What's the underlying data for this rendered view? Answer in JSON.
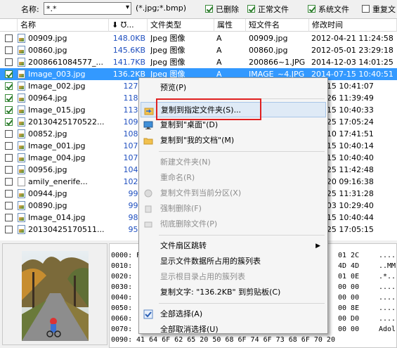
{
  "filter": {
    "name_label": "名称:",
    "name_value": "*.*",
    "ext_hint": "(*.jpg;*.bmp)",
    "checks": [
      {
        "label": "已删除",
        "checked": true
      },
      {
        "label": "正常文件",
        "checked": true
      },
      {
        "label": "系统文件",
        "checked": true
      },
      {
        "label": "重复文",
        "checked": false
      }
    ]
  },
  "columns": [
    "名称",
    "⬇ ℧...",
    "文件类型",
    "属性",
    "短文件名",
    "修改时间"
  ],
  "rows": [
    {
      "name": "00909.jpg",
      "size": "148.0KB",
      "type": "Jpeg 图像",
      "attr": "A",
      "short": "00909.jpg",
      "time": "2012-04-21 11:24:58",
      "checked": false,
      "icon": "jpg"
    },
    {
      "name": "00860.jpg",
      "size": "145.6KB",
      "type": "Jpeg 图像",
      "attr": "A",
      "short": "00860.jpg",
      "time": "2012-05-01 23:29:18",
      "checked": false,
      "icon": "jpg"
    },
    {
      "name": "2008661084577_...",
      "size": "141.7KB",
      "type": "Jpeg 图像",
      "attr": "A",
      "short": "200866~1.JPG",
      "time": "2014-12-03 14:01:25",
      "checked": false,
      "icon": "jpg"
    },
    {
      "name": "Image_003.jpg",
      "size": "136.2KB",
      "type": "Jpeg 图像",
      "attr": "A",
      "short": "IMAGE_~4.JPG",
      "time": "2014-07-15 10:40:51",
      "checked": true,
      "icon": "jpg",
      "selected": true
    },
    {
      "name": "Image_002.jpg",
      "size": "127.3",
      "type": "",
      "attr": "",
      "short": "",
      "time": "-07-15 10:41:07",
      "checked": true,
      "icon": "jpg"
    },
    {
      "name": "00964.jpg",
      "size": "118.4",
      "type": "",
      "attr": "",
      "short": "",
      "time": "-04-26 11:39:49",
      "checked": true,
      "icon": "jpg"
    },
    {
      "name": "Image_015.jpg",
      "size": "113.9",
      "type": "",
      "attr": "",
      "short": "",
      "time": "-07-15 10:40:33",
      "checked": true,
      "icon": "jpg"
    },
    {
      "name": "20130425170522...",
      "size": "109.1",
      "type": "",
      "attr": "",
      "short": "",
      "time": "-04-25 17:05:24",
      "checked": true,
      "icon": "jpg"
    },
    {
      "name": "00852.jpg",
      "size": "108.6",
      "type": "",
      "attr": "",
      "short": "",
      "time": "-04-10 17:41:51",
      "checked": false,
      "icon": "jpg"
    },
    {
      "name": "Image_001.jpg",
      "size": "107.7",
      "type": "",
      "attr": "",
      "short": "",
      "time": "-07-15 10:40:14",
      "checked": false,
      "icon": "jpg"
    },
    {
      "name": "Image_004.jpg",
      "size": "107.3",
      "type": "",
      "attr": "",
      "short": "",
      "time": "-07-15 10:40:40",
      "checked": false,
      "icon": "jpg"
    },
    {
      "name": "00956.jpg",
      "size": "104.8",
      "type": "",
      "attr": "",
      "short": "",
      "time": "-04-25 11:42:48",
      "checked": false,
      "icon": "jpg"
    },
    {
      "name": "amily_enerife...",
      "size": "102.2",
      "type": "",
      "attr": "",
      "short": "",
      "time": "-03-20 09:16:38",
      "checked": false,
      "icon": "doc"
    },
    {
      "name": "00944.jpg",
      "size": "99.5",
      "type": "",
      "attr": "",
      "short": "",
      "time": "-04-25 11:31:28",
      "checked": false,
      "icon": "jpg"
    },
    {
      "name": "00890.jpg",
      "size": "99.0",
      "type": "",
      "attr": "",
      "short": "",
      "time": "-12-03 10:29:40",
      "checked": false,
      "icon": "jpg"
    },
    {
      "name": "Image_014.jpg",
      "size": "98.7",
      "type": "",
      "attr": "",
      "short": "",
      "time": "-07-15 10:40:44",
      "checked": false,
      "icon": "jpg"
    },
    {
      "name": "20130425170511...",
      "size": "95.3",
      "type": "",
      "attr": "",
      "short": "",
      "time": "-04-25 17:05:15",
      "checked": false,
      "icon": "jpg"
    }
  ],
  "hex": [
    {
      "off": "0000:",
      "bytes": "FF D8 FF E0",
      "tail": "01 2C",
      "ascii": "...."
    },
    {
      "off": "0010:",
      "bytes": "",
      "tail": "4D 4D",
      "ascii": "..MM"
    },
    {
      "off": "0020:",
      "bytes": "",
      "tail": "01 0E",
      "ascii": ".*.."
    },
    {
      "off": "0030:",
      "bytes": "",
      "tail": "00 00",
      "ascii": "...."
    },
    {
      "off": "0040:",
      "bytes": "",
      "tail": "00 00",
      "ascii": "...."
    },
    {
      "off": "0050:",
      "bytes": "",
      "tail": "00 8E",
      "ascii": "...."
    },
    {
      "off": "0060:",
      "bytes": "",
      "tail": "00 D0",
      "ascii": "...."
    },
    {
      "off": "0070:",
      "bytes": "",
      "tail": "00 00",
      "ascii": "Adol"
    },
    {
      "off": "0090:",
      "bytes": "41 64 6F 62 65 20 50 68 6F 74 6F 73 68 6F 70 20",
      "tail": "",
      "ascii": ""
    }
  ],
  "menu": {
    "items": [
      {
        "label": "预览(P)",
        "disabled": false,
        "icon": ""
      },
      {
        "sep": true
      },
      {
        "label": "复制到指定文件夹(S)...",
        "disabled": false,
        "icon": "folder-arrow-icon",
        "highlight": true
      },
      {
        "label": "复制到\"桌面\"(D)",
        "disabled": false,
        "icon": "desktop-icon"
      },
      {
        "label": "复制到\"我的文档\"(M)",
        "disabled": false,
        "icon": "folder-icon"
      },
      {
        "sep": true
      },
      {
        "label": "新建文件夹(N)",
        "disabled": true,
        "icon": ""
      },
      {
        "label": "重命名(R)",
        "disabled": true,
        "icon": ""
      },
      {
        "label": "复制文件到当前分区(X)",
        "disabled": true,
        "icon": "copy-disabled-icon"
      },
      {
        "label": "强制删除(F)",
        "disabled": true,
        "icon": "delete-disabled-icon"
      },
      {
        "label": "彻底删除文件(P)",
        "disabled": true,
        "icon": "erase-disabled-icon"
      },
      {
        "sep": true
      },
      {
        "label": "文件扇区跳转",
        "disabled": false,
        "icon": "",
        "submenu": true
      },
      {
        "label": "显示文件数据所占用的簇列表",
        "disabled": false,
        "icon": ""
      },
      {
        "label": "显示根目录占用的簇列表",
        "disabled": true,
        "icon": ""
      },
      {
        "label": "复制文字: \"136.2KB\" 到剪贴板(C)",
        "disabled": false,
        "icon": ""
      },
      {
        "sep": true
      },
      {
        "label": "全部选择(A)",
        "disabled": false,
        "icon": "check-all-icon"
      },
      {
        "label": "全部取消选择(U)",
        "disabled": false,
        "icon": ""
      }
    ]
  }
}
